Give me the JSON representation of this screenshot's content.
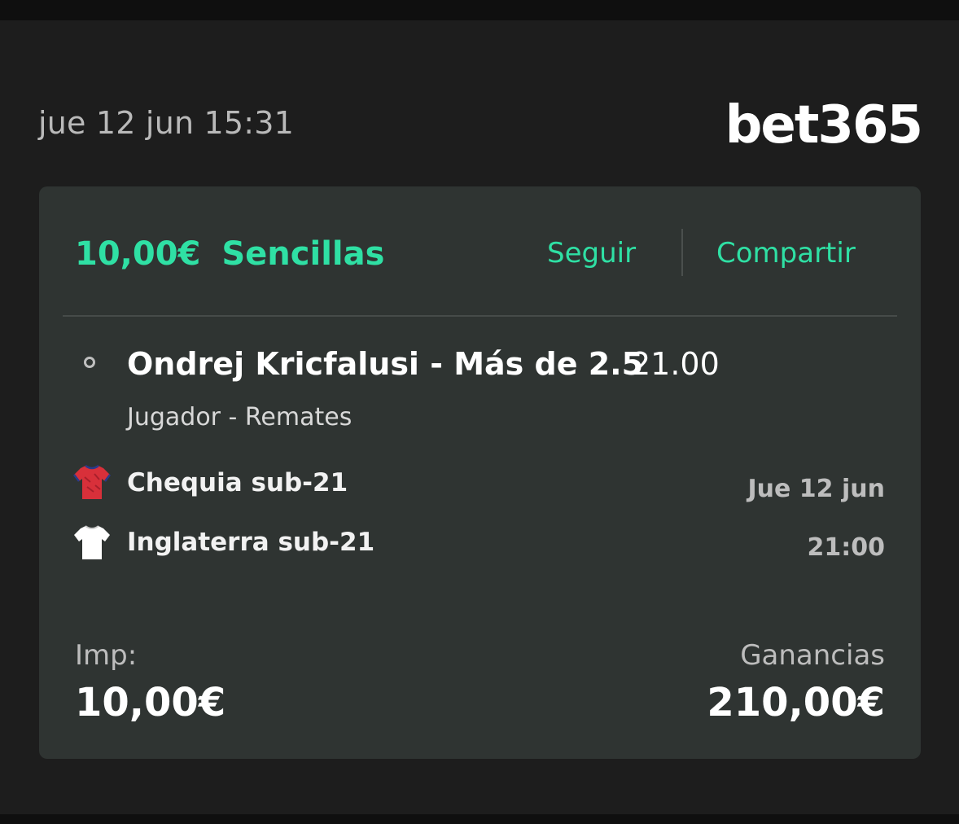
{
  "header": {
    "datetime": "jue 12 jun 15:31",
    "brand": "bet365"
  },
  "bet": {
    "stake_amount": "10,00€",
    "bet_type": "Sencillas",
    "follow_label": "Seguir",
    "share_label": "Compartir",
    "selection": "Ondrej Kricfalusi - Más de 2.5",
    "odds": "21.00",
    "market": "Jugador - Remates",
    "teams": [
      {
        "name": "Chequia sub-21",
        "shirt_color": "#d8303a",
        "icon": "shirt-icon"
      },
      {
        "name": "Inglaterra sub-21",
        "shirt_color": "#ffffff",
        "icon": "shirt-icon"
      }
    ],
    "event_date": "Jue 12 jun",
    "event_time": "21:00",
    "stake_label": "Imp:",
    "stake_value": "10,00€",
    "returns_label": "Ganancias",
    "returns_value": "210,00€"
  },
  "colors": {
    "accent": "#2fe0a4",
    "card_bg": "#2f3432",
    "page_bg": "#1d1d1d"
  }
}
